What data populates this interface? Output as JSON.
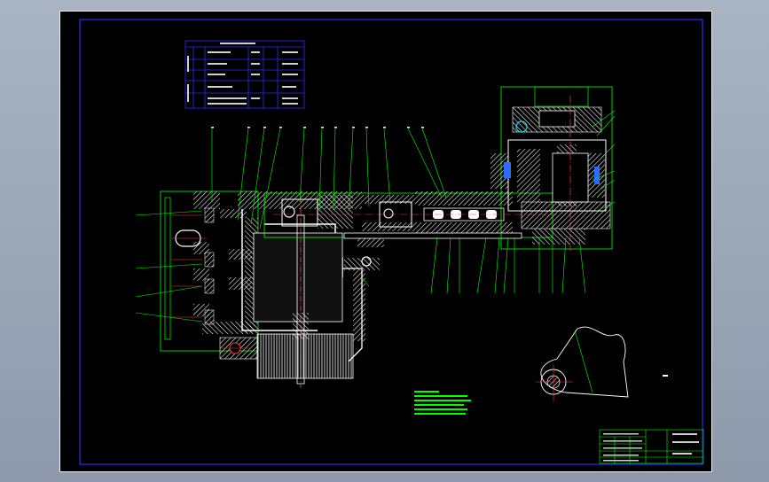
{
  "window": {
    "title": ""
  },
  "colors": {
    "background": "#000000",
    "frame": "#0000ff",
    "outline": "#00ff00",
    "hatch": "#ffffff",
    "centerline": "#ff3b3b",
    "dimension": "#00ff00",
    "accent": "#00e5ff"
  },
  "drawing": {
    "param_table": {
      "rows": 5,
      "columns": 5
    },
    "title_block": {},
    "notes": {}
  }
}
